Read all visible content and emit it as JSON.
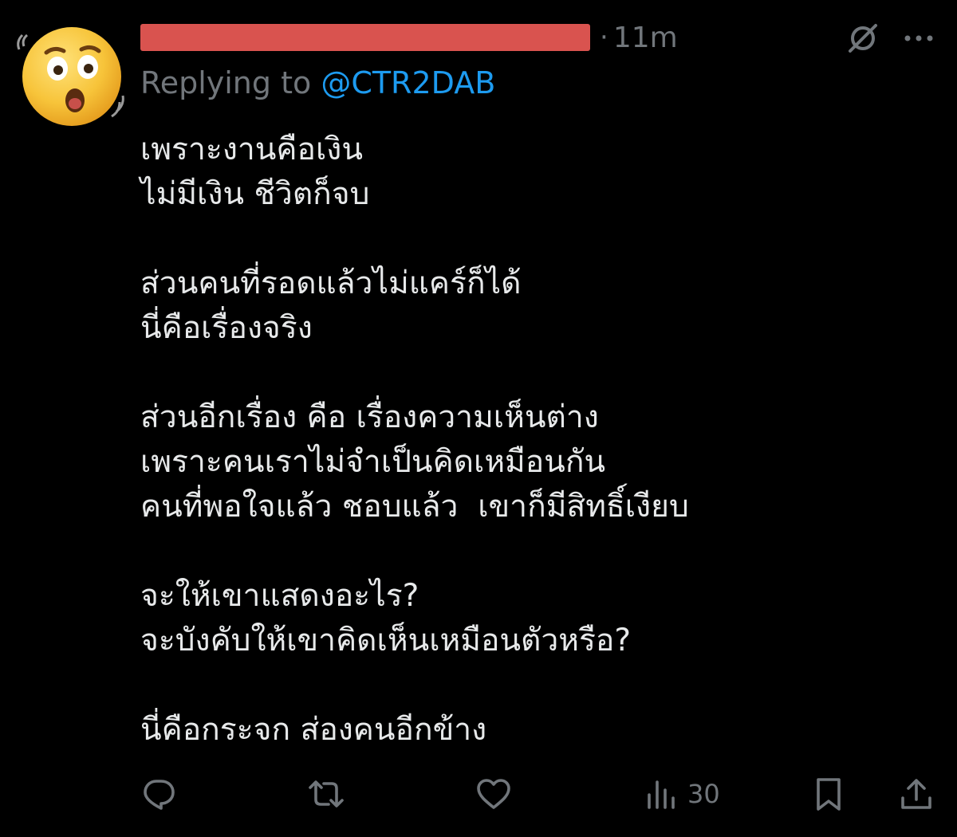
{
  "tweet": {
    "time": "11m",
    "dot": "·",
    "replying_prefix": "Replying to ",
    "replying_handle": "@CTR2DAB",
    "lines": [
      "เพราะงานคือเงิน",
      "ไม่มีเงิน ชีวิตก็จบ",
      "",
      "ส่วนคนที่รอดแล้วไม่แคร์ก็ได้",
      "นี่คือเรื่องจริง",
      "",
      "ส่วนอีกเรื่อง คือ เรื่องความเห็นต่าง",
      "เพราะคนเราไม่จำเป็นคิดเหมือนกัน",
      "คนที่พอใจแล้ว ชอบแล้ว  เขาก็มีสิทธิ์เงียบ",
      "",
      "จะให้เขาแสดงอะไร?",
      "จะบังคับให้เขาคิดเห็นเหมือนตัวหรือ?",
      "",
      "นี่คือกระจก ส่องคนอีกข้าง"
    ]
  },
  "actions": {
    "reply_icon": "reply-icon",
    "retweet_icon": "retweet-icon",
    "like_icon": "heart-icon",
    "views_icon": "views-icon",
    "views_count": "30",
    "bookmark_icon": "bookmark-icon",
    "share_icon": "share-icon"
  },
  "colors": {
    "background": "#000000",
    "text": "#e7e9ea",
    "muted": "#71767b",
    "link": "#1d9bf0",
    "redaction": "#d9534f"
  }
}
